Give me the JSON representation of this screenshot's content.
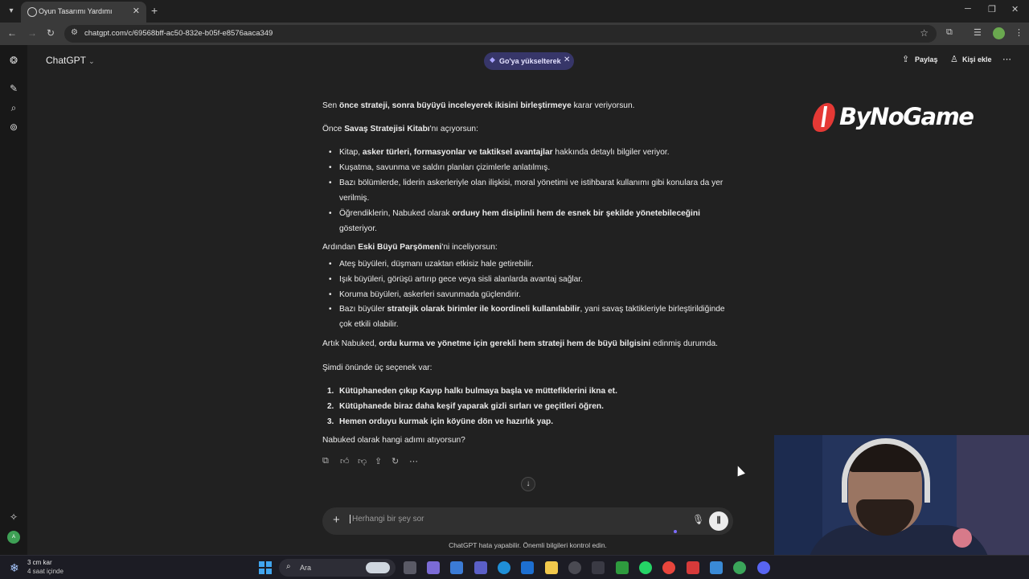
{
  "browser": {
    "tab_title": "Oyun Tasarımı Yardımı",
    "url": "chatgpt.com/c/69568bff-ac50-832e-b05f-e8576aaca349"
  },
  "header": {
    "model": "ChatGPT",
    "upgrade_label": "Go'ya yükselterek",
    "share": "Paylaş",
    "add_person": "Kişi ekle"
  },
  "message": {
    "p1": [
      {
        "t": "Sen ",
        "b": false
      },
      {
        "t": "önce strateji, sonra büyüyü inceleyerek ikisini birleştirmeye",
        "b": true
      },
      {
        "t": " karar veriyorsun.",
        "b": false
      }
    ],
    "p2": [
      {
        "t": "Önce ",
        "b": false
      },
      {
        "t": "Savaş Stratejisi Kitabı",
        "b": true
      },
      {
        "t": "'nı açıyorsun:",
        "b": false
      }
    ],
    "book_items": [
      [
        {
          "t": "Kitap, ",
          "b": false
        },
        {
          "t": "asker türleri, formasyonlar ve taktiksel avantajlar",
          "b": true
        },
        {
          "t": " hakkında detaylı bilgiler veriyor.",
          "b": false
        }
      ],
      [
        {
          "t": "Kuşatma, savunma ve saldırı planları çizimlerle anlatılmış.",
          "b": false
        }
      ],
      [
        {
          "t": "Bazı bölümlerde, liderin askerleriyle olan ilişkisi, moral yönetimi ve istihbarat kullanımı gibi konulara da yer verilmiş.",
          "b": false
        }
      ],
      [
        {
          "t": "Öğrendiklerin, Nabuked olarak ",
          "b": false
        },
        {
          "t": "orduну hem disiplinli hem de esnek bir şekilde yönetebileceğini",
          "b": true
        },
        {
          "t": " gösteriyor.",
          "b": false
        }
      ]
    ],
    "p3": [
      {
        "t": "Ardından ",
        "b": false
      },
      {
        "t": "Eski Büyü Parşömeni",
        "b": true
      },
      {
        "t": "'ni inceliyorsun:",
        "b": false
      }
    ],
    "scroll_items": [
      [
        {
          "t": "Ateş büyüleri, düşmanı uzaktan etkisiz hale getirebilir.",
          "b": false
        }
      ],
      [
        {
          "t": "Işık büyüleri, görüşü artırıp gece veya sisli alanlarda avantaj sağlar.",
          "b": false
        }
      ],
      [
        {
          "t": "Koruma büyüleri, askerleri savunmada güçlendirir.",
          "b": false
        }
      ],
      [
        {
          "t": "Bazı büyüler ",
          "b": false
        },
        {
          "t": "stratejik olarak birimler ile koordineli kullanılabilir",
          "b": true
        },
        {
          "t": ", yani savaş taktikleriyle birleştirildiğinde çok etkili olabilir.",
          "b": false
        }
      ]
    ],
    "p4": [
      {
        "t": "Artık Nabuked, ",
        "b": false
      },
      {
        "t": "ordu kurma ve yönetme için gerekli hem strateji hem de büyü bilgisini",
        "b": true
      },
      {
        "t": " edinmiş durumda.",
        "b": false
      }
    ],
    "p5": "Şimdi önünde üç seçenek var:",
    "options": [
      {
        "n": "1.",
        "t": "Kütüphaneden çıkıp Kayıp halkı bulmaya başla ve müttefiklerini ikna et."
      },
      {
        "n": "2.",
        "t": "Kütüphanede biraz daha keşif yaparak gizli sırları ve geçitleri öğren."
      },
      {
        "n": "3.",
        "t": "Hemen orduyu kurmak için köyüne dön ve hazırlık yap."
      }
    ],
    "question": "Nabuked olarak hangi adımı atıyorsun?"
  },
  "composer": {
    "placeholder": "Herhangi bir şey sor",
    "disclaimer": "ChatGPT hata yapabilir. Önemli bilgileri kontrol edin."
  },
  "overlay": {
    "logo_text": "ByNoGame"
  },
  "taskbar": {
    "weather_temp": "3 cm kar",
    "weather_sub": "4 saat içinde",
    "search_label": "Ara"
  },
  "colors": {
    "background": "#212121",
    "upgrade_pill": "#373669",
    "logo_accent": "#e53935"
  }
}
